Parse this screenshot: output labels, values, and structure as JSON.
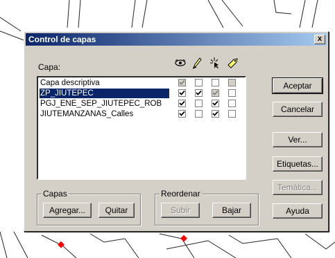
{
  "window": {
    "title": "Control de capas",
    "close_label": "x"
  },
  "layers_label": "Capa:",
  "column_icons": [
    "eye-icon",
    "pencil-icon",
    "cursor-star-icon",
    "tag-icon"
  ],
  "layers": [
    {
      "name": "Capa descriptiva",
      "selected": false,
      "checks": [
        "checked-disabled",
        "unchecked",
        "unchecked",
        "disabled"
      ]
    },
    {
      "name": "ZP_JIUTEPEC",
      "selected": true,
      "checks": [
        "checked",
        "checked",
        "checked-disabled",
        "unchecked"
      ]
    },
    {
      "name": "PGJ_ENE_SEP_JIUTEPEC_ROB",
      "selected": false,
      "checks": [
        "checked",
        "unchecked",
        "checked",
        "unchecked"
      ]
    },
    {
      "name": "JIUTEMANZANAS_Calles",
      "selected": false,
      "checks": [
        "checked",
        "unchecked",
        "checked",
        "unchecked"
      ]
    }
  ],
  "buttons": {
    "accept": "Aceptar",
    "cancel": "Cancelar",
    "view": "Ver...",
    "labels": "Etiquetas...",
    "thematic": "Temática...",
    "help": "Ayuda"
  },
  "layers_group": {
    "title": "Capas",
    "add": "Agregar...",
    "remove": "Quitar"
  },
  "reorder_group": {
    "title": "Reordenar",
    "up": "Subir",
    "down": "Bajar"
  },
  "colors": {
    "titlebar_start": "#0a246a",
    "titlebar_end": "#a6caf0",
    "dialog_bg": "#d4d0c8",
    "map_point": "#ff0000"
  }
}
